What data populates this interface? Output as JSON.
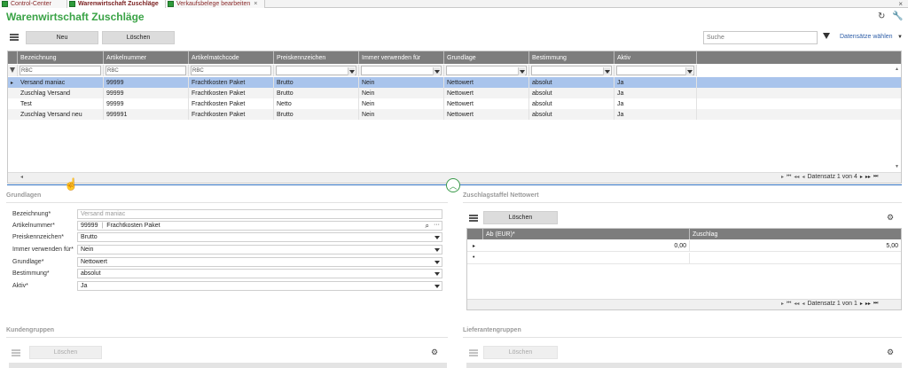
{
  "tabs": [
    {
      "label": "Control-Center",
      "active": false
    },
    {
      "label": "Warenwirtschaft Zuschläge",
      "active": true
    },
    {
      "label": "Verkaufsbelege bearbeiten",
      "active": false
    }
  ],
  "page_title": "Warenwirtschaft Zuschläge",
  "toolbar": {
    "new_label": "Neu",
    "delete_label": "Löschen",
    "search_placeholder": "Suche",
    "select_records_label": "Datensätze wählen"
  },
  "grid": {
    "columns": [
      "Bezeichnung",
      "Artikelnummer",
      "Artikelmatchcode",
      "Preiskennzeichen",
      "Immer verwenden für",
      "Grundlage",
      "Bestimmung",
      "Aktiv"
    ],
    "filters": [
      "RBC",
      "RBC",
      "RBC",
      "",
      "",
      "",
      "",
      ""
    ],
    "rows": [
      [
        "Versand maniac",
        "99999",
        "Frachtkosten Paket",
        "Brutto",
        "Nein",
        "Nettowert",
        "absolut",
        "Ja"
      ],
      [
        "Zuschlag Versand",
        "99999",
        "Frachtkosten Paket",
        "Brutto",
        "Nein",
        "Nettowert",
        "absolut",
        "Ja"
      ],
      [
        "Test",
        "99999",
        "Frachtkosten Paket",
        "Netto",
        "Nein",
        "Nettowert",
        "absolut",
        "Ja"
      ],
      [
        "Zuschlag Versand neu",
        "999991",
        "Frachtkosten Paket",
        "Brutto",
        "Nein",
        "Nettowert",
        "absolut",
        "Ja"
      ]
    ],
    "pager": "Datensatz 1 von 4"
  },
  "grundlagen": {
    "title": "Grundlagen",
    "fields": [
      {
        "label": "Bezeichnung*",
        "value": "Versand maniac",
        "placeholder": true,
        "type": "text"
      },
      {
        "label": "Artikelnummer*",
        "value": "99999",
        "extra": "Frachtkosten Paket",
        "type": "lookup"
      },
      {
        "label": "Preiskennzeichen*",
        "value": "Brutto",
        "type": "select"
      },
      {
        "label": "Immer verwenden für*",
        "value": "Nein",
        "type": "select"
      },
      {
        "label": "Grundlage*",
        "value": "Nettowert",
        "type": "select"
      },
      {
        "label": "Bestimmung*",
        "value": "absolut",
        "type": "select"
      },
      {
        "label": "Aktiv*",
        "value": "Ja",
        "type": "select"
      }
    ]
  },
  "zuschlag": {
    "title": "Zuschlagstaffel Nettowert",
    "delete_label": "Löschen",
    "columns": [
      "Ab (EUR)*",
      "Zuschlag"
    ],
    "rows": [
      [
        "0,00",
        "5,00"
      ]
    ],
    "pager": "Datensatz 1 von 1"
  },
  "kundengruppen": {
    "title": "Kundengruppen",
    "delete_label": "Löschen"
  },
  "lieferantengruppen": {
    "title": "Lieferantengruppen",
    "delete_label": "Löschen"
  }
}
